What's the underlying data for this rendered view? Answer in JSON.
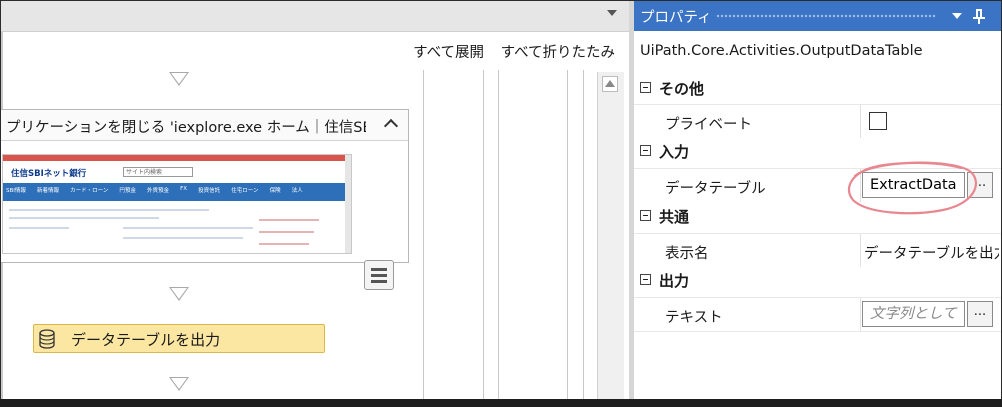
{
  "designer": {
    "expand_all": "すべて展開",
    "collapse_all": "すべて折りたたみ",
    "close_app_title": "プリケーションを閉じる 'iexplore.exe  ホーム｜住信SBI",
    "thumbnail": {
      "logo_text": "住信SBIネット銀行",
      "search_placeholder": "サイト内検索",
      "nav_items": [
        "SBI情報",
        "新着情報",
        "カード・ローン",
        "円預金",
        "外貨預金",
        "FX",
        "投資信託",
        "住宅ローン",
        "保険",
        "法人"
      ]
    },
    "output_activity_label": "データテーブルを出力"
  },
  "properties": {
    "title": "プロパティ",
    "class_name": "UiPath.Core.Activities.OutputDataTable",
    "sections": [
      {
        "label": "その他",
        "rows": [
          {
            "name": "プライベート",
            "type": "checkbox",
            "checked": false
          }
        ]
      },
      {
        "label": "入力",
        "rows": [
          {
            "name": "データテーブル",
            "type": "textbox",
            "value": "ExtractData",
            "button": "..."
          }
        ]
      },
      {
        "label": "共通",
        "rows": [
          {
            "name": "表示名",
            "type": "text",
            "value": "データテーブルを出力"
          }
        ]
      },
      {
        "label": "出力",
        "rows": [
          {
            "name": "テキスト",
            "type": "textbox",
            "placeholder": "文字列として",
            "button": "..."
          }
        ]
      }
    ]
  },
  "colors": {
    "titlebar": "#3b73c5",
    "activity_fill": "#fbe7a1",
    "annotation": "#e8878f"
  },
  "icons": [
    "dropdown-icon",
    "collapse-icon",
    "hamburger-menu-icon",
    "database-icon",
    "pin-icon",
    "scroll-up-icon",
    "section-toggle-icon"
  ]
}
